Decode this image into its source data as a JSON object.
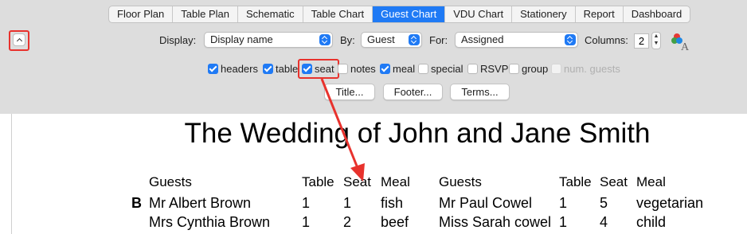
{
  "tabs": [
    "Floor Plan",
    "Table Plan",
    "Schematic",
    "Table Chart",
    "Guest Chart",
    "VDU Chart",
    "Stationery",
    "Report",
    "Dashboard"
  ],
  "active_tab": "Guest Chart",
  "controls": {
    "display_label": "Display:",
    "display_value": "Display name",
    "by_label": "By:",
    "by_value": "Guest",
    "for_label": "For:",
    "for_value": "Assigned",
    "columns_label": "Columns:",
    "columns_value": "2"
  },
  "checkboxes": [
    {
      "label": "headers",
      "checked": true
    },
    {
      "label": "table",
      "checked": true
    },
    {
      "label": "seat",
      "checked": true
    },
    {
      "label": "notes",
      "checked": false
    },
    {
      "label": "meal",
      "checked": true
    },
    {
      "label": "special",
      "checked": false
    },
    {
      "label": "RSVP",
      "checked": false
    },
    {
      "label": "group",
      "checked": false
    },
    {
      "label": "num. guests",
      "checked": false,
      "disabled": true
    }
  ],
  "buttons": {
    "title": "Title...",
    "footer": "Footer...",
    "terms": "Terms..."
  },
  "chart": {
    "title": "The Wedding of John and Jane Smith",
    "headers": {
      "guests": "Guests",
      "table": "Table",
      "seat": "Seat",
      "meal": "Meal"
    },
    "section_letter": "B",
    "left_rows": [
      {
        "name": "Mr Albert Brown",
        "table": "1",
        "seat": "1",
        "meal": "fish"
      },
      {
        "name": "Mrs Cynthia Brown",
        "table": "1",
        "seat": "2",
        "meal": "beef"
      }
    ],
    "right_rows": [
      {
        "name": "Mr Paul Cowel",
        "table": "1",
        "seat": "5",
        "meal": "vegetarian"
      },
      {
        "name": "Miss Sarah cowel",
        "table": "1",
        "seat": "4",
        "meal": "child"
      }
    ]
  },
  "colors": {
    "accent": "#1f7af5",
    "highlight": "#e8322d",
    "panel": "#dddddd"
  }
}
